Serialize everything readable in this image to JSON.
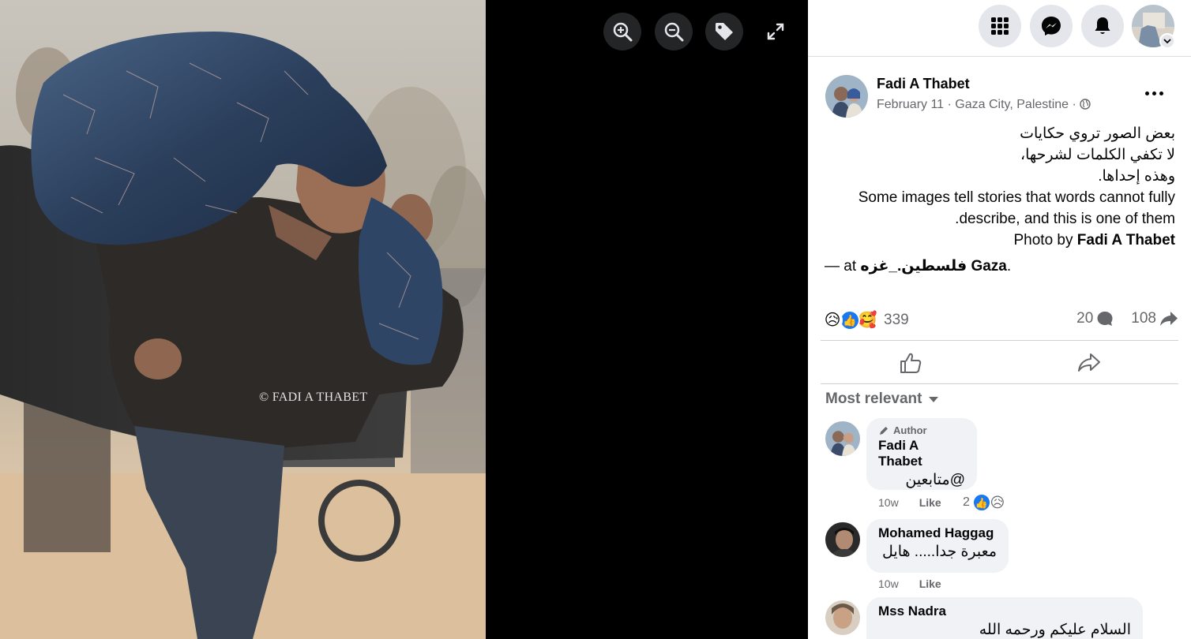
{
  "viewer": {
    "watermark": "© FADI A THABET",
    "tools": [
      {
        "name": "zoom-in",
        "icon": "zoom-in-icon"
      },
      {
        "name": "zoom-out",
        "icon": "zoom-out-icon"
      },
      {
        "name": "tag",
        "icon": "tag-icon"
      },
      {
        "name": "fullscreen",
        "icon": "expand-icon"
      }
    ]
  },
  "topnav": {
    "buttons": [
      {
        "name": "menu",
        "icon": "grid-menu-icon"
      },
      {
        "name": "messenger",
        "icon": "messenger-icon"
      },
      {
        "name": "notifications",
        "icon": "bell-icon"
      }
    ],
    "account_icon": "chevron-down-icon"
  },
  "post": {
    "author": "Fadi A Thabet",
    "date": "February 11",
    "sep1": " · ",
    "location": "Gaza City, Palestine",
    "sep2": " · ",
    "privacy_icon": "globe-icon",
    "caption": {
      "ar_line1": "بعض الصور تروي حكايات",
      "ar_line2": "لا تكفي الكلمات لشرحها،",
      "ar_line3": "وهذه إحداها.",
      "en_line1": "Some images tell stories that words cannot fully",
      "en_line2": ".describe, and this is one of them",
      "credit_prefix": "Photo by ",
      "credit_name": "Fadi A Thabet"
    },
    "checkin": {
      "prefix": "— at ",
      "place": "فلسطين._غزه Gaza",
      "suffix": "."
    },
    "reactions": {
      "emojis": [
        "😥",
        "👍",
        "🥰"
      ],
      "count": "339"
    },
    "comments_count": "20",
    "shares_count": "108",
    "actions": [
      {
        "name": "like",
        "icon": "thumbs-up-icon"
      },
      {
        "name": "share",
        "icon": "share-arrow-icon"
      }
    ],
    "colors": {
      "link_blue": "#1877f2",
      "muted": "#65676b",
      "bubble": "#f0f2f5"
    }
  },
  "comments": {
    "sort_label": "Most relevant",
    "items": [
      {
        "badge": "Author",
        "name": "Fadi A Thabet",
        "text": "@متابعين",
        "time": "10w",
        "like_label": "Like",
        "reactions": {
          "count": "2",
          "emojis": [
            "👍",
            "😥"
          ]
        }
      },
      {
        "name": "Mohamed Haggag",
        "text": "معبرة جدا..... هايل",
        "time": "10w",
        "like_label": "Like"
      },
      {
        "name": "Mss Nadra",
        "text": "السلام عليكم ورحمه الله"
      }
    ]
  }
}
